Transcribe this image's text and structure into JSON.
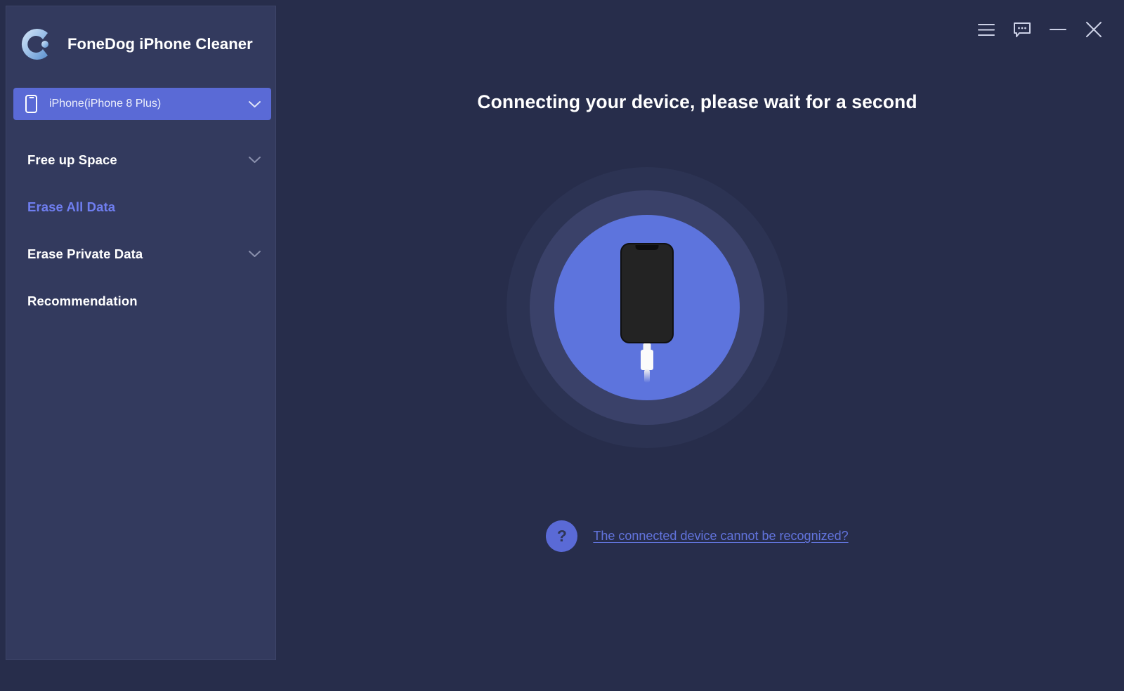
{
  "app": {
    "title": "FoneDog iPhone Cleaner",
    "logo_icon": "fonedog-c-logo"
  },
  "titlebar": {
    "buttons": [
      {
        "name": "menu",
        "icon": "hamburger-menu-icon",
        "label": "Menu"
      },
      {
        "name": "feedback",
        "icon": "chat-bubble-icon",
        "label": "Feedback"
      },
      {
        "name": "minimize",
        "icon": "minimize-icon",
        "label": "Minimize"
      },
      {
        "name": "close",
        "icon": "close-icon",
        "label": "Close"
      }
    ]
  },
  "sidebar": {
    "device_selector": {
      "icon": "phone-outline-icon",
      "value": "iPhone(iPhone 8 Plus)",
      "chevron": "chevron-down-icon"
    },
    "nav_items": [
      {
        "label": "Free up Space",
        "expandable": true,
        "active": false
      },
      {
        "label": "Erase All Data",
        "expandable": false,
        "active": true
      },
      {
        "label": "Erase Private Data",
        "expandable": true,
        "active": false
      },
      {
        "label": "Recommendation",
        "expandable": false,
        "active": false
      }
    ]
  },
  "main": {
    "heading": "Connecting your device, please wait for a second",
    "illustration": {
      "device_icon": "iphone-device-icon",
      "cable_icon": "lightning-cable-icon"
    },
    "help": {
      "icon": "question-mark-icon",
      "icon_glyph": "?",
      "link_text": "The connected device cannot be recognized?"
    }
  },
  "colors": {
    "window_background": "#272d4b",
    "sidebar_background": "#333a5e",
    "accent": "#5a6ad6",
    "active_nav": "#6f7ef0",
    "link": "#6274dd",
    "ring_outer": "#2c3353",
    "ring_mid": "#3a4169",
    "ring_inner": "#5d74dd"
  }
}
